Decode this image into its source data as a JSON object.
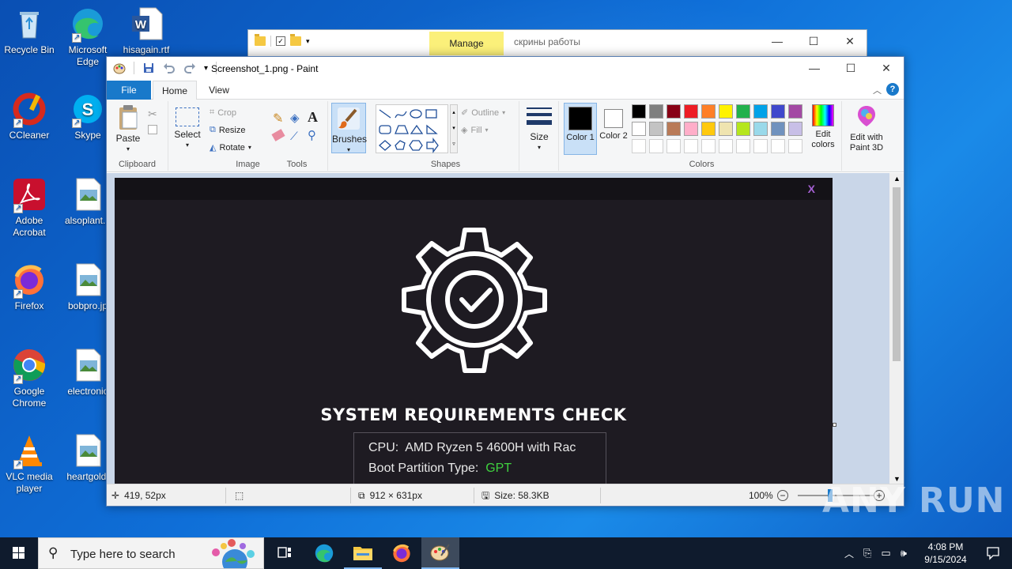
{
  "desktop": {
    "icons": [
      {
        "label": "Recycle Bin"
      },
      {
        "label": "Microsoft Edge"
      },
      {
        "label": "hisagain.rtf"
      },
      {
        "label": "CCleaner"
      },
      {
        "label": "Skype"
      },
      {
        "label": "Adobe Acrobat"
      },
      {
        "label": "alsoplant..."
      },
      {
        "label": "Firefox"
      },
      {
        "label": "bobpro.jp"
      },
      {
        "label": "Google Chrome"
      },
      {
        "label": "electronic"
      },
      {
        "label": "VLC media player"
      },
      {
        "label": "heartgold."
      }
    ]
  },
  "explorer": {
    "manage_tab": "Manage",
    "title": "скрины работы"
  },
  "paint": {
    "title": "Screenshot_1.png - Paint",
    "tabs": {
      "file": "File",
      "home": "Home",
      "view": "View"
    },
    "clipboard": {
      "paste": "Paste",
      "group": "Clipboard"
    },
    "image": {
      "select": "Select",
      "crop": "Crop",
      "resize": "Resize",
      "rotate": "Rotate",
      "group": "Image"
    },
    "tools": {
      "group": "Tools"
    },
    "brushes": {
      "label": "Brushes"
    },
    "shapes": {
      "outline": "Outline",
      "fill": "Fill",
      "group": "Shapes"
    },
    "size": {
      "label": "Size"
    },
    "colors": {
      "color1": "Color 1",
      "color2": "Color 2",
      "edit_colors": "Edit colors",
      "group": "Colors",
      "palette_row1": [
        "#000000",
        "#7f7f7f",
        "#880015",
        "#ed1c24",
        "#ff7f27",
        "#fff200",
        "#22b14c",
        "#00a2e8",
        "#3f48cc",
        "#a349a4"
      ],
      "palette_row2": [
        "#ffffff",
        "#c3c3c3",
        "#b97a57",
        "#ffaec9",
        "#ffc90e",
        "#efe4b0",
        "#b5e61d",
        "#99d9ea",
        "#7092be",
        "#c8bfe7"
      ]
    },
    "paint3d": {
      "label": "Edit with Paint 3D"
    },
    "status": {
      "cursor": "419, 52px",
      "dimensions": "912 × 631px",
      "size": "Size: 58.3KB",
      "zoom": "100%"
    }
  },
  "image_content": {
    "close": "X",
    "title": "SYSTEM REQUIREMENTS CHECK",
    "cpu_label": "CPU:",
    "cpu_value": "AMD Ryzen 5 4600H with Rac",
    "boot_label": "Boot Partition Type:",
    "boot_value": "GPT"
  },
  "taskbar": {
    "search_placeholder": "Type here to search",
    "time": "4:08 PM",
    "date": "9/15/2024"
  },
  "watermark": "ANY RUN"
}
